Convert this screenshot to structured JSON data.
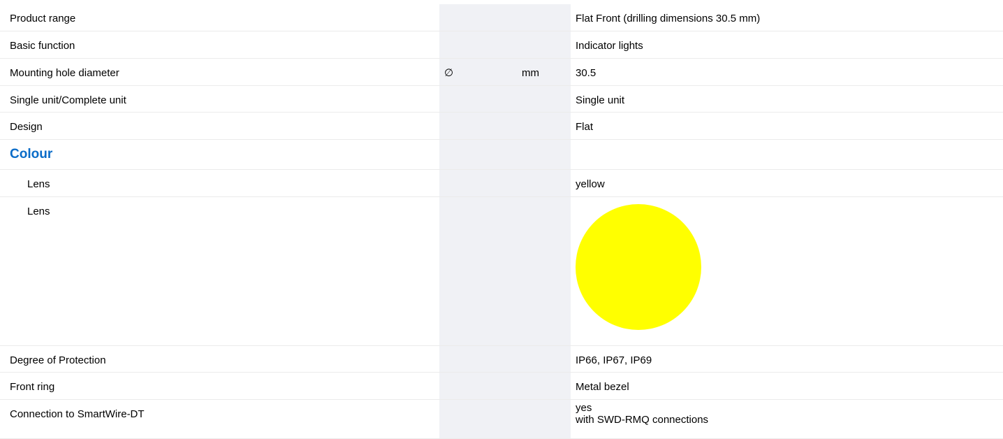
{
  "header": {
    "partial_heading": ""
  },
  "rows": [
    {
      "label": "Product range",
      "symbol": "",
      "unit": "",
      "value": "Flat Front (drilling dimensions 30.5 mm)"
    },
    {
      "label": "Basic function",
      "symbol": "",
      "unit": "",
      "value": "Indicator lights"
    },
    {
      "label": "Mounting hole diameter",
      "symbol": "∅",
      "unit": "mm",
      "value": "30.5"
    },
    {
      "label": "Single unit/Complete unit",
      "symbol": "",
      "unit": "",
      "value": "Single unit"
    },
    {
      "label": "Design",
      "symbol": "",
      "unit": "",
      "value": "Flat"
    }
  ],
  "colour_section": {
    "title": "Colour",
    "lens_label": "Lens",
    "lens_value": "yellow",
    "lens_swatch_label": "Lens",
    "lens_swatch_color": "#ffff00"
  },
  "rows_after": [
    {
      "label": "Degree of Protection",
      "value": "IP66, IP67, IP69"
    },
    {
      "label": "Front ring",
      "value": "Metal bezel"
    },
    {
      "label": "Connection to SmartWire-DT",
      "value_line1": "yes",
      "value_line2": "with SWD-RMQ connections"
    }
  ],
  "colors": {
    "accent": "#0a6cc8",
    "column_shade": "#f0f1f5",
    "row_border": "#ebebeb"
  }
}
